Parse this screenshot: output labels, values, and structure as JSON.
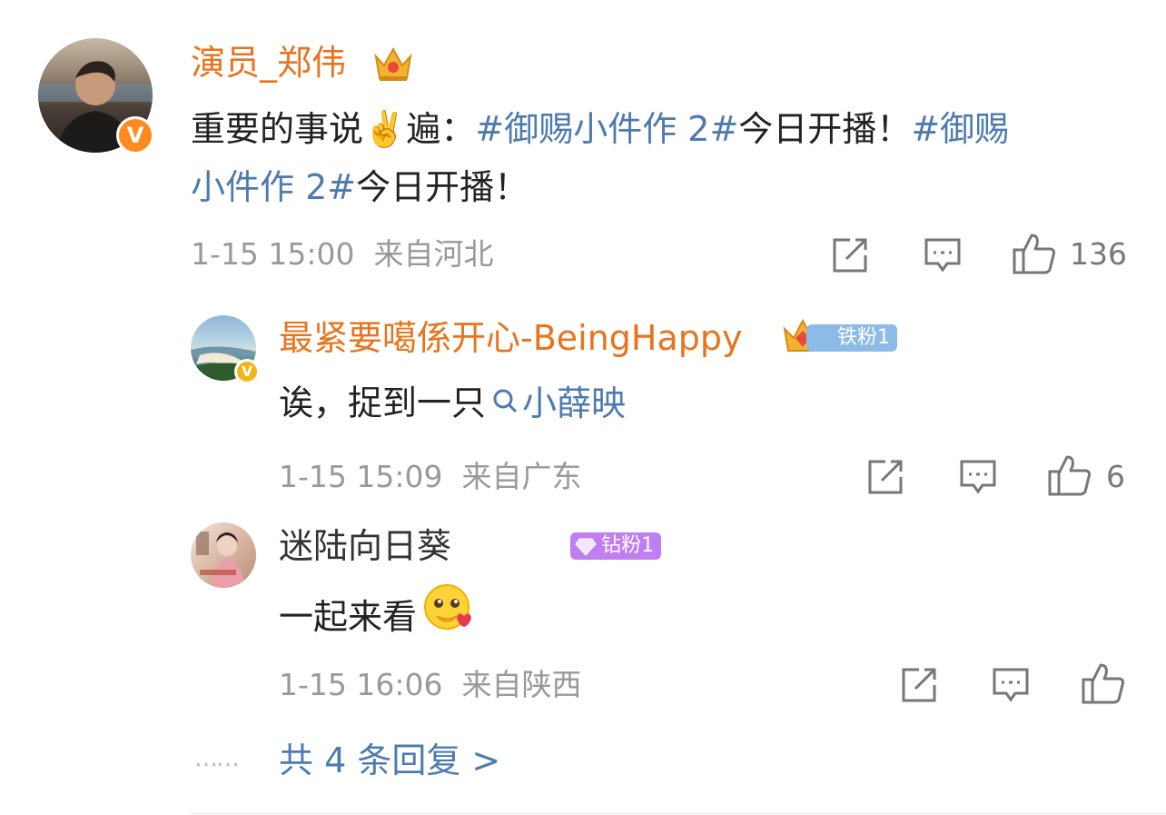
{
  "post": {
    "username": "演员_郑伟",
    "verified_icon": "v-badge-orange",
    "text_prefix": "重要的事说",
    "text_emoji": "✌️",
    "text_after_emoji": "遍：",
    "topic_1": "#御赐小件作 2#",
    "text_mid": "今日开播！",
    "topic_2_line1": "#御赐",
    "topic_2_line2": "小件作 2#",
    "text_end": "今日开播！",
    "time": "1-15 15:00",
    "location": "来自河北",
    "like_count": "136"
  },
  "replies": [
    {
      "username": "最紧要噶係开心-BeingHappy",
      "fan_badge": "铁粉1",
      "fan_badge_color": "#8cbbe8",
      "text": "诶，捉到一只",
      "mention": "小薛映",
      "time": "1-15 15:09",
      "location": "来自广东",
      "like_count": "6"
    },
    {
      "username": "迷陆向日葵",
      "fan_badge": "钻粉1",
      "fan_badge_color": "#c07ef0",
      "text": "一起来看",
      "time": "1-15 16:06",
      "location": "来自陕西",
      "like_count": ""
    }
  ],
  "more_dots": "……",
  "more_replies_label": "共 4 条回复 >"
}
